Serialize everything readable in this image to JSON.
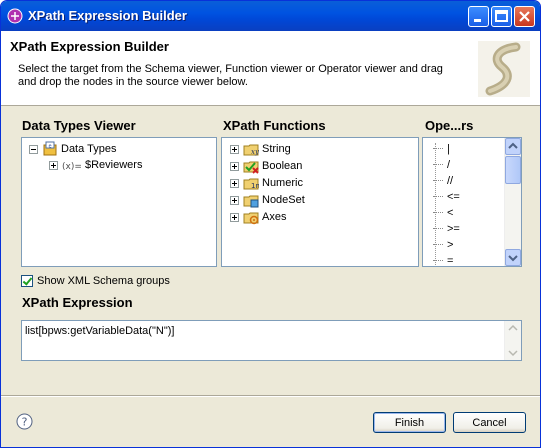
{
  "window": {
    "title": "XPath Expression Builder"
  },
  "header": {
    "title": "XPath Expression Builder",
    "description": "Select the target from the Schema viewer, Function viewer or Operator viewer and drag and drop the nodes in the source viewer below."
  },
  "data_types": {
    "title": "Data Types Viewer",
    "root_label": "Data Types",
    "child_label": "$Reviewers"
  },
  "functions": {
    "title": "XPath Functions",
    "items": [
      "String",
      "Boolean",
      "Numeric",
      "NodeSet",
      "Axes"
    ]
  },
  "operators": {
    "title": "Ope...rs",
    "items": [
      "|",
      "/",
      "//",
      "<=",
      "<",
      ">=",
      ">",
      "="
    ]
  },
  "options": {
    "show_schema_groups_label": "Show XML Schema groups",
    "show_schema_groups_checked": true
  },
  "expression": {
    "title": "XPath Expression",
    "value": "list[bpws:getVariableData(\"N\")]"
  },
  "buttons": {
    "finish": "Finish",
    "cancel": "Cancel"
  },
  "colors": {
    "titlebar": "#0053e1",
    "dialog_bg": "#ece9d8",
    "panel_border": "#7f9db9"
  }
}
